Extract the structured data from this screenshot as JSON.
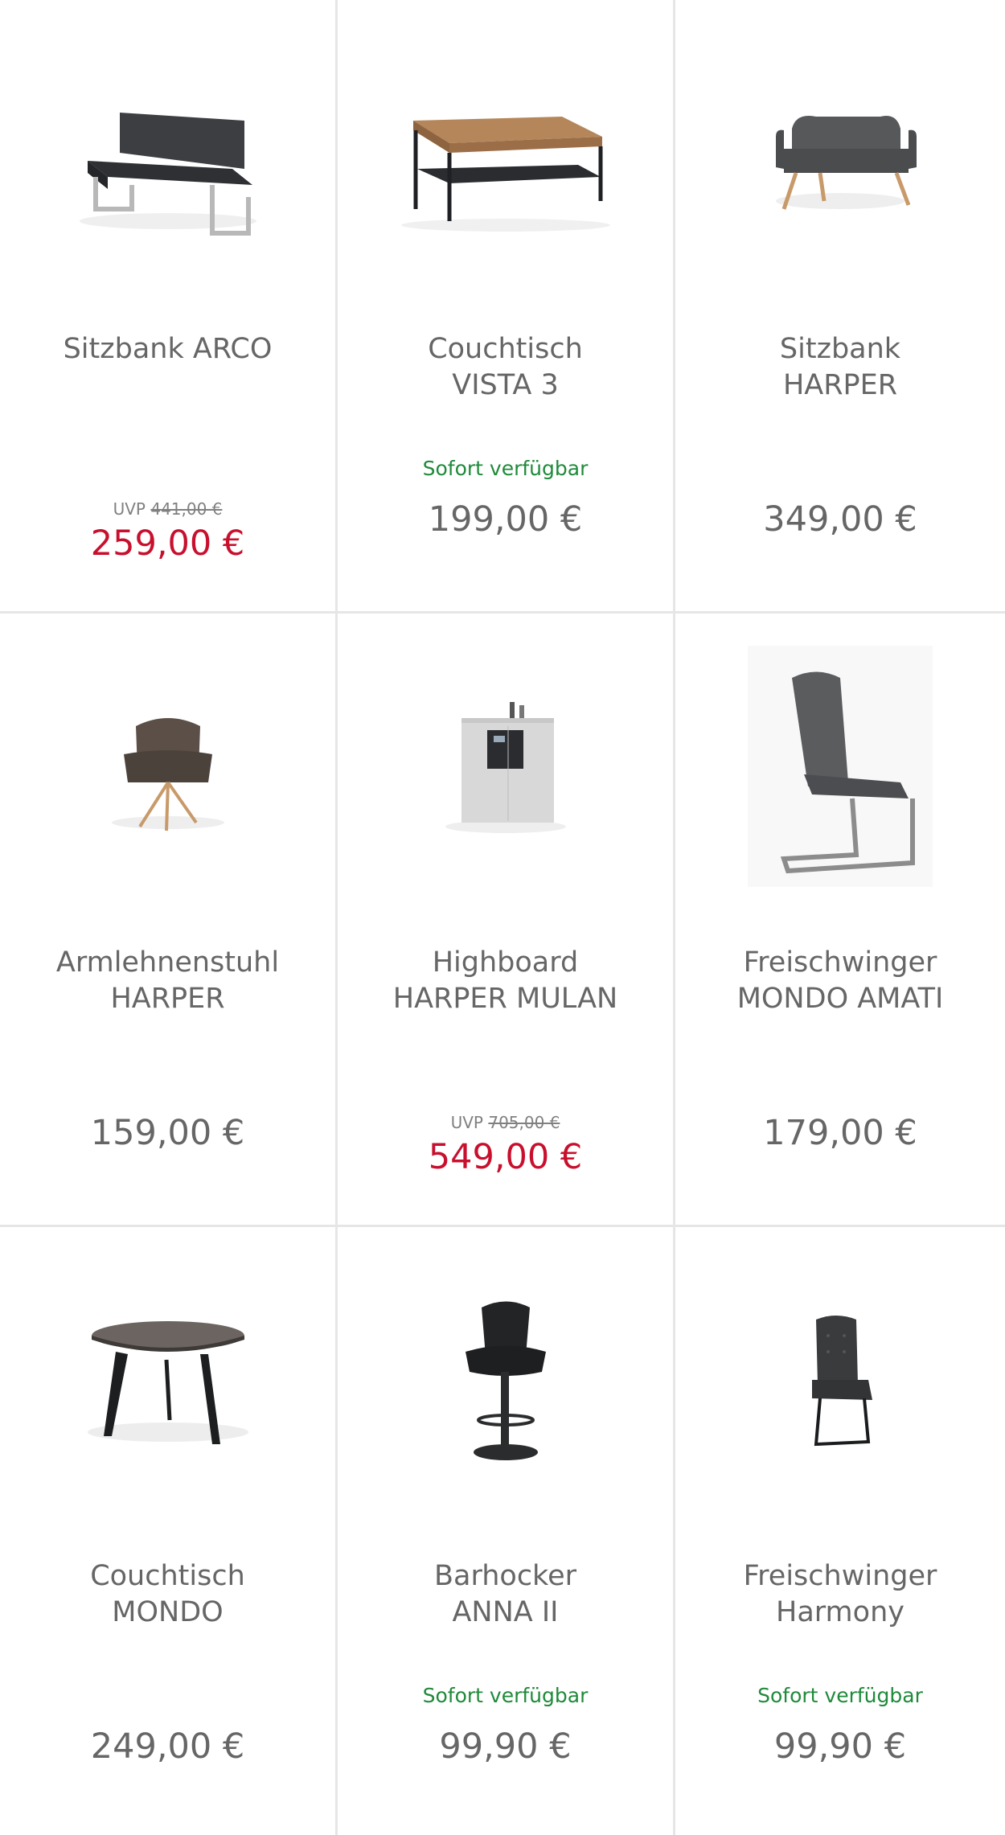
{
  "products": [
    {
      "name_line1": "Sitzbank ARCO",
      "name_line2": "",
      "availability": "",
      "uvp_label": "UVP",
      "uvp_old": "441,00 €",
      "price": "259,00 €",
      "sale": true,
      "icon": "bench-arco-image"
    },
    {
      "name_line1": "Couchtisch",
      "name_line2": "VISTA 3",
      "availability": "Sofort verfügbar",
      "uvp_label": "",
      "uvp_old": "",
      "price": "199,00 €",
      "sale": false,
      "icon": "coffee-table-vista-image"
    },
    {
      "name_line1": "Sitzbank",
      "name_line2": "HARPER",
      "availability": "",
      "uvp_label": "",
      "uvp_old": "",
      "price": "349,00 €",
      "sale": false,
      "icon": "bench-harper-image"
    },
    {
      "name_line1": "Armlehnenstuhl",
      "name_line2": "HARPER",
      "availability": "",
      "uvp_label": "",
      "uvp_old": "",
      "price": "159,00 €",
      "sale": false,
      "icon": "armchair-harper-image"
    },
    {
      "name_line1": "Highboard",
      "name_line2": "HARPER MULAN",
      "availability": "",
      "uvp_label": "UVP",
      "uvp_old": "705,00 €",
      "price": "549,00 €",
      "sale": true,
      "icon": "highboard-image"
    },
    {
      "name_line1": "Freischwinger",
      "name_line2": "MONDO AMATI",
      "availability": "",
      "uvp_label": "",
      "uvp_old": "",
      "price": "179,00 €",
      "sale": false,
      "icon": "cantilever-chair-image"
    },
    {
      "name_line1": "Couchtisch",
      "name_line2": "MONDO",
      "availability": "",
      "uvp_label": "",
      "uvp_old": "",
      "price": "249,00 €",
      "sale": false,
      "icon": "round-coffee-table-image"
    },
    {
      "name_line1": "Barhocker",
      "name_line2": "ANNA II",
      "availability": "Sofort verfügbar",
      "uvp_label": "",
      "uvp_old": "",
      "price": "99,90 €",
      "sale": false,
      "icon": "bar-stool-image"
    },
    {
      "name_line1": "Freischwinger",
      "name_line2": "Harmony",
      "availability": "Sofort verfügbar",
      "uvp_label": "",
      "uvp_old": "",
      "price": "99,90 €",
      "sale": false,
      "icon": "cantilever-chair-harmony-image"
    }
  ],
  "colors": {
    "sale_price": "#c8102e",
    "availability": "#1f8a3a",
    "text": "#666666",
    "divider": "#e6e6e6"
  }
}
